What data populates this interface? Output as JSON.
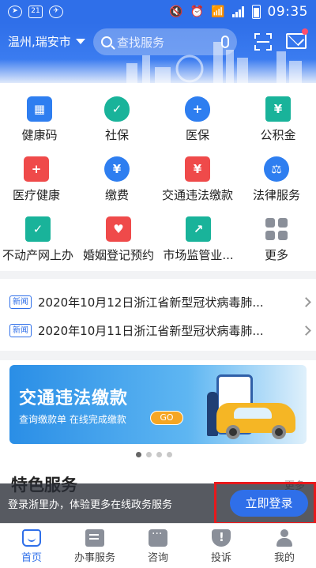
{
  "status_bar": {
    "time": "09:35",
    "icons": [
      "navigation-icon",
      "sim-icon",
      "app-icon",
      "mute-icon",
      "alarm-icon",
      "wifi-icon",
      "signal-icon",
      "battery-icon"
    ]
  },
  "header": {
    "city": "温州,瑞安市",
    "search_placeholder": "查找服务",
    "accent": "#2f6fe9"
  },
  "services": [
    {
      "label": "健康码",
      "icon": "qr-code-icon"
    },
    {
      "label": "社保",
      "icon": "social-security-icon"
    },
    {
      "label": "医保",
      "icon": "medical-insurance-icon"
    },
    {
      "label": "公积金",
      "icon": "housing-fund-icon"
    },
    {
      "label": "医疗健康",
      "icon": "medical-kit-icon"
    },
    {
      "label": "缴费",
      "icon": "payment-icon"
    },
    {
      "label": "交通违法缴款",
      "icon": "traffic-fine-icon"
    },
    {
      "label": "法律服务",
      "icon": "scales-icon"
    },
    {
      "label": "不动产网上办",
      "icon": "real-estate-icon"
    },
    {
      "label": "婚姻登记预约",
      "icon": "marriage-icon"
    },
    {
      "label": "市场监管业...",
      "icon": "market-supervision-icon"
    },
    {
      "label": "更多",
      "icon": "more-grid-icon"
    }
  ],
  "news": [
    {
      "tag": "新闻",
      "text": "2020年10月12日浙江省新型冠状病毒肺..."
    },
    {
      "tag": "新闻",
      "text": "2020年10月11日浙江省新型冠状病毒肺..."
    }
  ],
  "banner": {
    "title": "交通违法缴款",
    "subtitle": "查询缴款单  在线完成缴款",
    "go": "GO"
  },
  "carousel": {
    "count": 4,
    "active": 0
  },
  "feature": {
    "title": "特色服务",
    "more": "更多"
  },
  "login": {
    "text": "登录浙里办，体验更多在线政务服务",
    "button": "立即登录"
  },
  "nav": [
    {
      "label": "首页",
      "icon": "home-icon",
      "active": true
    },
    {
      "label": "办事服务",
      "icon": "service-list-icon",
      "active": false
    },
    {
      "label": "咨询",
      "icon": "chat-icon",
      "active": false
    },
    {
      "label": "投诉",
      "icon": "complaint-icon",
      "active": false
    },
    {
      "label": "我的",
      "icon": "profile-icon",
      "active": false
    }
  ]
}
